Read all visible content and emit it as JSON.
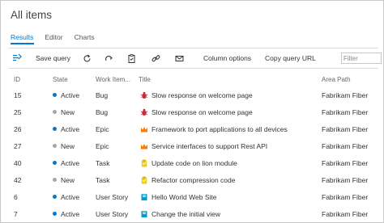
{
  "page": {
    "title": "All items"
  },
  "tabs": [
    {
      "label": "Results",
      "active": true
    },
    {
      "label": "Editor",
      "active": false
    },
    {
      "label": "Charts",
      "active": false
    }
  ],
  "toolbar": {
    "save_query": "Save query",
    "column_options": "Column options",
    "copy_query_url": "Copy query URL",
    "filter_placeholder": "Filter"
  },
  "columns": {
    "id": "ID",
    "state": "State",
    "work_item_type": "Work Item...",
    "title": "Title",
    "area_path": "Area Path"
  },
  "colors": {
    "accent": "#0078d4",
    "active_state": "#0078d4",
    "new_state": "#a6a6a6",
    "bug": "#cc293d",
    "epic": "#ff7b00",
    "task": "#f2cb1d",
    "user_story": "#009ccc"
  },
  "rows": [
    {
      "id": "15",
      "state": "Active",
      "type": "Bug",
      "icon": "bug-icon",
      "title": "Slow response on welcome page",
      "area": "Fabrikam Fiber"
    },
    {
      "id": "25",
      "state": "New",
      "type": "Bug",
      "icon": "bug-icon",
      "title": "Slow response on welcome page",
      "area": "Fabrikam Fiber"
    },
    {
      "id": "26",
      "state": "Active",
      "type": "Epic",
      "icon": "crown-icon",
      "title": "Framework to port applications to all devices",
      "area": "Fabrikam Fiber"
    },
    {
      "id": "27",
      "state": "New",
      "type": "Epic",
      "icon": "crown-icon",
      "title": "Service interfaces to support Rest API",
      "area": "Fabrikam Fiber"
    },
    {
      "id": "40",
      "state": "Active",
      "type": "Task",
      "icon": "clipboard-icon",
      "title": "Update code on lion module",
      "area": "Fabrikam Fiber"
    },
    {
      "id": "42",
      "state": "New",
      "type": "Task",
      "icon": "clipboard-icon",
      "title": "Refactor compression code",
      "area": "Fabrikam Fiber"
    },
    {
      "id": "6",
      "state": "Active",
      "type": "User Story",
      "icon": "book-icon",
      "title": "Hello World Web Site",
      "area": "Fabrikam Fiber"
    },
    {
      "id": "7",
      "state": "Active",
      "type": "User Story",
      "icon": "book-icon",
      "title": "Change the initial view",
      "area": "Fabrikam Fiber"
    }
  ]
}
